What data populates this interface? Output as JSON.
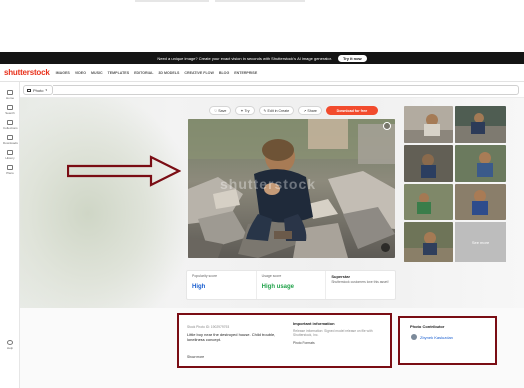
{
  "promo": {
    "text": "Need a unique image? Create your exact vision in seconds with Shutterstock's AI image generator.",
    "button": "Try it now"
  },
  "nav": {
    "logo": "shutterstock",
    "items": [
      "IMAGES",
      "VIDEO",
      "MUSIC",
      "TEMPLATES",
      "EDITORIAL",
      "3D MODELS",
      "CREATIVE FLOW",
      "BLOG",
      "ENTERPRISE"
    ]
  },
  "search": {
    "type_label": "Photo",
    "placeholder": ""
  },
  "rail": {
    "items": [
      "Home",
      "Search",
      "Collections",
      "Downloads",
      "History",
      "Plans",
      "Help"
    ]
  },
  "toolbar": {
    "save": "Save",
    "try": "Try",
    "edit": "Edit in Create",
    "share": "Share",
    "download": "Download for free"
  },
  "image": {
    "watermark": "shutterstock"
  },
  "grid": {
    "see_more": "See more"
  },
  "metrics": {
    "popularity_label": "Popularity score",
    "popularity_value": "High",
    "usage_label": "Usage score",
    "usage_value": "High usage",
    "superstar_title": "Superstar",
    "superstar_desc": "Shutterstock customers love this asset!"
  },
  "description": {
    "stock_id": "Stock Photo ID: 1902979793",
    "text": "Little boy near the destroyed house. Child trouble, loneliness concept.",
    "show_more": "Show more",
    "important_title": "Important information",
    "release_info": "Release information: Signed model release on file with Shutterstock, Inc.",
    "photo_formats": "Photo Formats"
  },
  "contributor": {
    "title": "Photo Contributor",
    "name": "Zbynek Kasluzdan"
  },
  "colors": {
    "accent": "#f24b2d",
    "annotation": "#7a0d14",
    "link": "#1a5fd0",
    "green": "#21a24a"
  }
}
